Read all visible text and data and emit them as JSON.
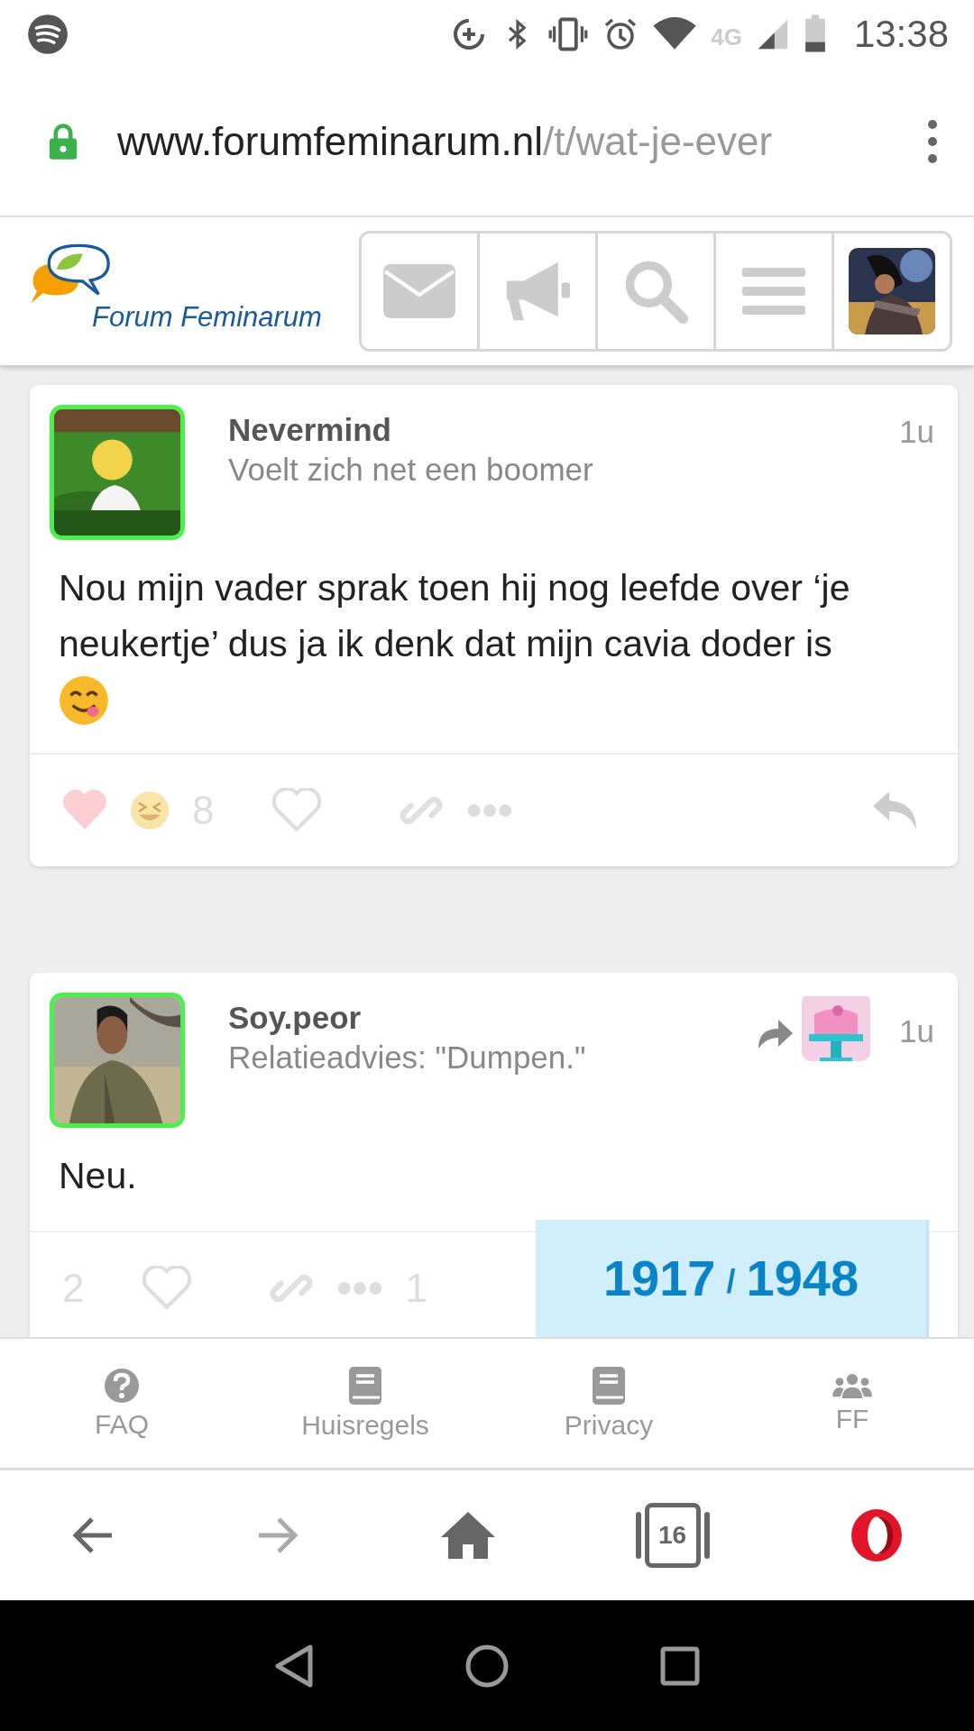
{
  "status_bar": {
    "time": "13:38",
    "network": "4G"
  },
  "browser": {
    "secure": true,
    "url_host": "www.forumfeminarum.nl",
    "url_path": "/t/wat-je-ever"
  },
  "site_header": {
    "logo_text": "Forum Feminarum"
  },
  "posts": [
    {
      "username": "Nevermind",
      "user_title": "Voelt zich net een boomer",
      "time": "1u",
      "body": "Nou mijn vader sprak toen hij nog leefde over ‘je neukertje’ dus ja ik denk dat mijn cavia doder is",
      "reaction_count": "8",
      "liked": false,
      "is_reply": false,
      "reply_button": true
    },
    {
      "username": "Soy.peor",
      "user_title": "Relatieadvies: \"Dumpen.\"",
      "time": "1u",
      "body": "Neu.",
      "like_count": "2",
      "liked": false,
      "reply_count": "1",
      "is_reply": true
    }
  ],
  "progress": {
    "current": "1917",
    "separator": "/",
    "total": "1948"
  },
  "footer_links": [
    {
      "label": "FAQ",
      "kind": "help"
    },
    {
      "label": "Huisregels",
      "kind": "book"
    },
    {
      "label": "Privacy",
      "kind": "book"
    },
    {
      "label": "FF",
      "kind": "group"
    }
  ],
  "browser_toolbar": {
    "back_disabled": false,
    "forward_disabled": true,
    "tab_count": "16"
  }
}
